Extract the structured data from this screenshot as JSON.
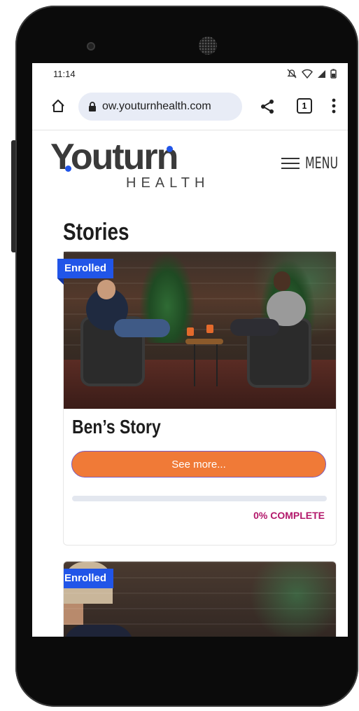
{
  "status_bar": {
    "time": "11:14"
  },
  "browser": {
    "url": "ow.youturnhealth.com",
    "tab_count": "1"
  },
  "site": {
    "logo_word": "Youturn",
    "logo_sub": "HEALTH",
    "menu_label": "MENU"
  },
  "section_title": "Stories",
  "cards": [
    {
      "badge": "Enrolled",
      "title": "Ben’s Story",
      "button": "See more...",
      "progress": 0,
      "progress_label": "0% COMPLETE"
    },
    {
      "badge": "Enrolled"
    }
  ],
  "colors": {
    "accent_blue": "#2155e8",
    "button_orange": "#f07a37",
    "progress_text": "#b3186b"
  },
  "icons": [
    "home-icon",
    "lock-icon",
    "share-icon",
    "tab-count-icon",
    "more-vert-icon",
    "mute-icon",
    "wifi-icon",
    "signal-icon",
    "battery-icon",
    "menu-icon"
  ]
}
